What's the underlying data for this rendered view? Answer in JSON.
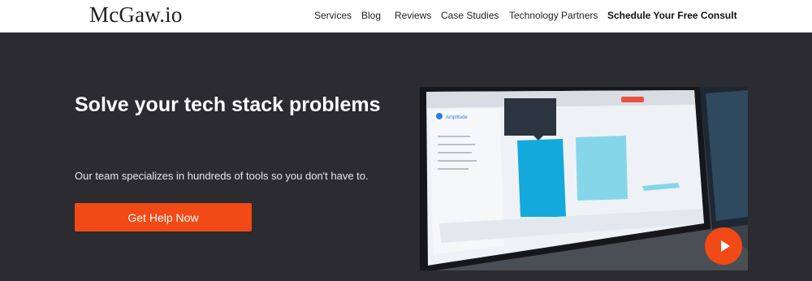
{
  "header": {
    "logo": "McGaw.io",
    "nav": [
      {
        "label": "Services"
      },
      {
        "label": "Blog"
      },
      {
        "label": "Reviews"
      },
      {
        "label": "Case Studies"
      },
      {
        "label": "Technology Partners"
      },
      {
        "label": "Schedule Your Free Consult"
      }
    ]
  },
  "hero": {
    "headline": "Solve your tech stack problems",
    "subline": "Our team specializes in hundreds of tools so you don't have to.",
    "button_label": "Get Help Now",
    "accent_color": "#f24a16",
    "background_color": "#2b2b30"
  },
  "video": {
    "screen_app_label": "Amplitude",
    "play_icon": "play-icon"
  }
}
